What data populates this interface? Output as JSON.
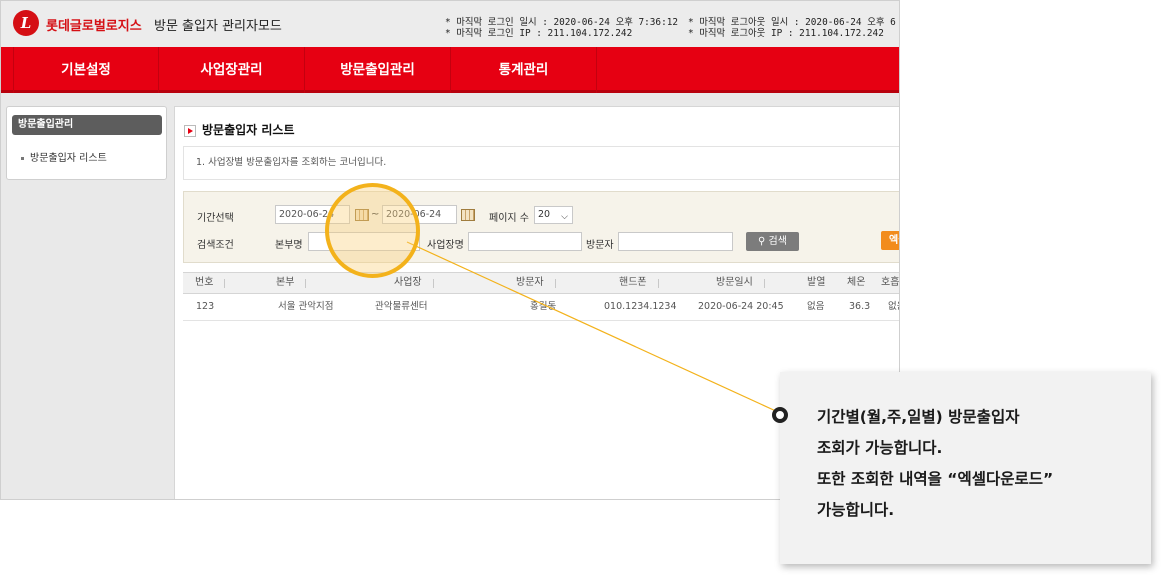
{
  "header": {
    "logo_mark": "L",
    "brand": "롯데글로벌로지스",
    "subtitle": "방문 출입자 관리자모드",
    "last_login_time": "* 마직막 로그인 일시 : 2020-06-24 오후 7:36:12",
    "last_login_ip": "* 마직막 로그인 IP : 211.104.172.242",
    "last_logout_time": "* 마직막 로그아웃 일시 : 2020-06-24 오후 6",
    "last_logout_ip": "* 마직막 로그아웃 IP : 211.104.172.242"
  },
  "nav": {
    "items": [
      {
        "label": "기본설정"
      },
      {
        "label": "사업장관리"
      },
      {
        "label": "방문출입관리"
      },
      {
        "label": "통계관리"
      }
    ]
  },
  "sidebar": {
    "title": "방문출입관리",
    "items": [
      {
        "label": "방문출입자 리스트"
      }
    ]
  },
  "main": {
    "title": "방문출입자 리스트",
    "description": "1.   사업장별 방문출입자를 조회하는 코너입니다.",
    "search": {
      "period_label": "기간선택",
      "date_from": "2020-06-24",
      "tilde": "~",
      "date_to": "2020-06-24",
      "page_size_label": "페이지 수",
      "page_size_value": "20",
      "condition_label": "검색조건",
      "branch_label": "본부명",
      "branch_value": "",
      "site_label": "사업장명",
      "site_value": "",
      "visitor_label": "방문자",
      "visitor_value": "",
      "search_button": "검색",
      "excel_button": "엑셀"
    },
    "table": {
      "headers": [
        "번호",
        "본부",
        "사업장",
        "방문자",
        "핸드폰",
        "방문일시",
        "발열",
        "체온",
        "호흡"
      ],
      "rows": [
        [
          "123",
          "서울 관악지점",
          "관악물류센터",
          "홍길동",
          "010.1234.1234",
          "2020-06-24  20:45",
          "없음",
          "36.3",
          "없음"
        ]
      ]
    }
  },
  "callout": {
    "lines": [
      "기간별(월,주,일별) 방문출입자",
      "조회가 가능합니다.",
      "또한 조회한 내역을 “엑셀다운로드”",
      "가능합니다."
    ]
  },
  "colors": {
    "brand_red": "#e60012",
    "highlight": "#f3b21b",
    "excel_orange": "#f28c1d"
  }
}
